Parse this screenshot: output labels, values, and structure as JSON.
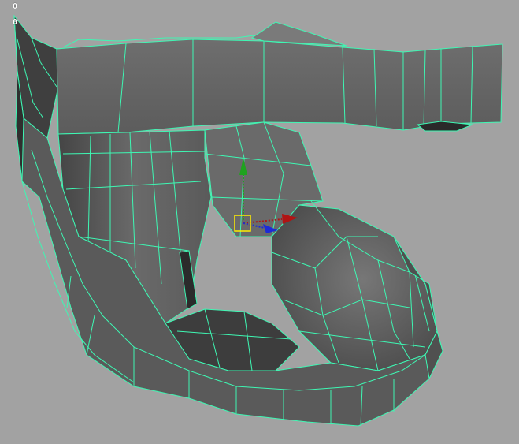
{
  "viewport": {
    "hud_lines": [
      "0",
      "0"
    ],
    "colors": {
      "background": "#a2a2a2",
      "wireframe": "#3ef7b3",
      "face_light": "#7c7c7c",
      "face_mid": "#5f5f5f",
      "face_dark": "#3a3a3a",
      "manip_y_axis": "#1fa31f",
      "manip_x_axis": "#b01414",
      "manip_z_axis": "#1d2bd6",
      "manip_center": "#ffee00"
    },
    "icons": {
      "manipulator": "move-manipulator-icon",
      "y_arrow": "arrow-up-icon",
      "x_arrow": "arrow-right-icon",
      "z_arrow": "arrow-diagonal-icon"
    }
  }
}
